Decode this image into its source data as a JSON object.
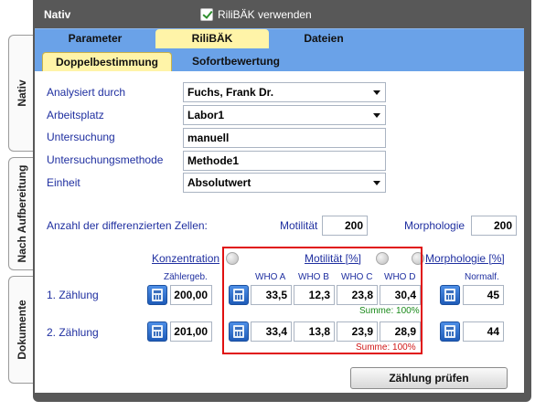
{
  "vertical_tabs": [
    "Nativ",
    "Nach Aufbereitung",
    "Dokumente"
  ],
  "window": {
    "title": "Nativ",
    "checkbox_label": "RiliBÄK verwenden",
    "checkbox_checked": true
  },
  "main_tabs": [
    "Parameter",
    "RiliBÄK",
    "Dateien"
  ],
  "sub_tabs": [
    "Doppelbestimmung",
    "Sofortbewertung"
  ],
  "form": {
    "analysiert_label": "Analysiert durch",
    "analysiert_value": "Fuchs, Frank Dr.",
    "arbeitsplatz_label": "Arbeitsplatz",
    "arbeitsplatz_value": "Labor1",
    "untersuchung_label": "Untersuchung",
    "untersuchung_value": "manuell",
    "methode_label": "Untersuchungsmethode",
    "methode_value": "Methode1",
    "einheit_label": "Einheit",
    "einheit_value": "Absolutwert"
  },
  "cells": {
    "label": "Anzahl der differenzierten Zellen:",
    "motilitaet_label": "Motilität",
    "motilitaet_value": "200",
    "morphologie_label": "Morphologie",
    "morphologie_value": "200"
  },
  "grid": {
    "konzentration_label": "Konzentration",
    "motilitaet_label": "Motilität [%]",
    "morphologie_label": "Morphologie [%]",
    "zaehlergeb_label": "Zählergeb.",
    "who_a": "WHO A",
    "who_b": "WHO B",
    "who_c": "WHO C",
    "who_d": "WHO  D",
    "normalf_label": "Normalf.",
    "rows": [
      {
        "label": "1. Zählung",
        "konz": "200,00",
        "a": "33,5",
        "b": "12,3",
        "c": "23,8",
        "d": "30,4",
        "summe": "Summe: 100%",
        "morph": "45"
      },
      {
        "label": "2. Zählung",
        "konz": "201,00",
        "a": "33,4",
        "b": "13,8",
        "c": "23,9",
        "d": "28,9",
        "summe": "Summe: 100%",
        "morph": "44"
      }
    ]
  },
  "button_label": "Zählung prüfen",
  "colors": {
    "tab_blue": "#6aa2e8",
    "tab_active": "#fff4a8",
    "label_blue": "#1f2fa0",
    "highlight_red": "#e01010",
    "sum_green": "#1a8a1a"
  }
}
